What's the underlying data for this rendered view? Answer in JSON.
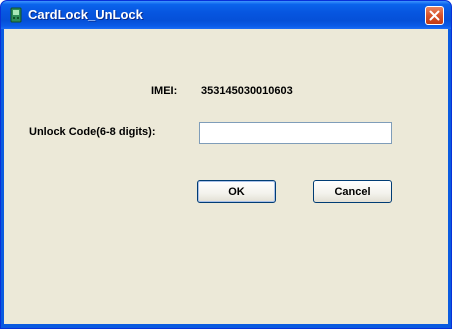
{
  "window": {
    "title": "CardLock_UnLock"
  },
  "form": {
    "imei_label": "IMEI:",
    "imei_value": "353145030010603",
    "unlock_label": "Unlock Code(6-8 digits):",
    "unlock_value": ""
  },
  "buttons": {
    "ok_label": "OK",
    "cancel_label": "Cancel"
  },
  "icons": {
    "app": "app-icon",
    "close": "close-icon"
  },
  "colors": {
    "titlebar": "#0a5be0",
    "client": "#ece9d8",
    "close_button": "#d8532a"
  }
}
